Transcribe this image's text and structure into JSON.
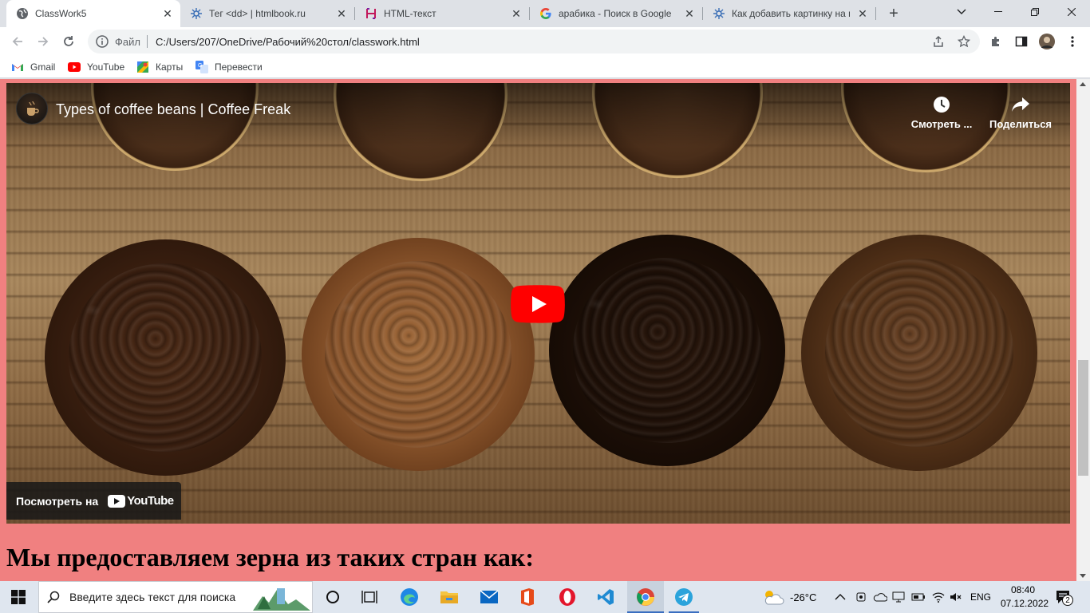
{
  "browser": {
    "tabs": [
      {
        "title": "ClassWork5",
        "icon": "globe-icon",
        "active": true
      },
      {
        "title": "Тег <dd> | htmlbook.ru",
        "icon": "htmlbook-icon"
      },
      {
        "title": "HTML-текст",
        "icon": "html-text-icon"
      },
      {
        "title": "арабика - Поиск в Google",
        "icon": "google-icon"
      },
      {
        "title": "Как добавить картинку на в",
        "icon": "htmlbook-icon"
      }
    ],
    "omnibox": {
      "scheme_label": "Файл",
      "url": "C:/Users/207/OneDrive/Рабочий%20стол/classwork.html"
    },
    "bookmarks": [
      {
        "label": "Gmail",
        "icon": "gmail-icon"
      },
      {
        "label": "YouTube",
        "icon": "youtube-icon"
      },
      {
        "label": "Карты",
        "icon": "maps-icon"
      },
      {
        "label": "Перевести",
        "icon": "translate-icon"
      }
    ]
  },
  "page": {
    "background_color": "#f08080",
    "video": {
      "title": "Types of coffee beans | Coffee Freak",
      "watch_later_label": "Смотреть ...",
      "share_label": "Поделиться",
      "watch_on_label": "Посмотреть на",
      "youtube_wordmark": "YouTube"
    },
    "heading": "Мы предоставляем зерна из таких стран как:"
  },
  "taskbar": {
    "search_placeholder": "Введите здесь текст для поиска",
    "weather": "-26°C",
    "language": "ENG",
    "time": "08:40",
    "date": "07.12.2022",
    "notification_count": "2"
  }
}
